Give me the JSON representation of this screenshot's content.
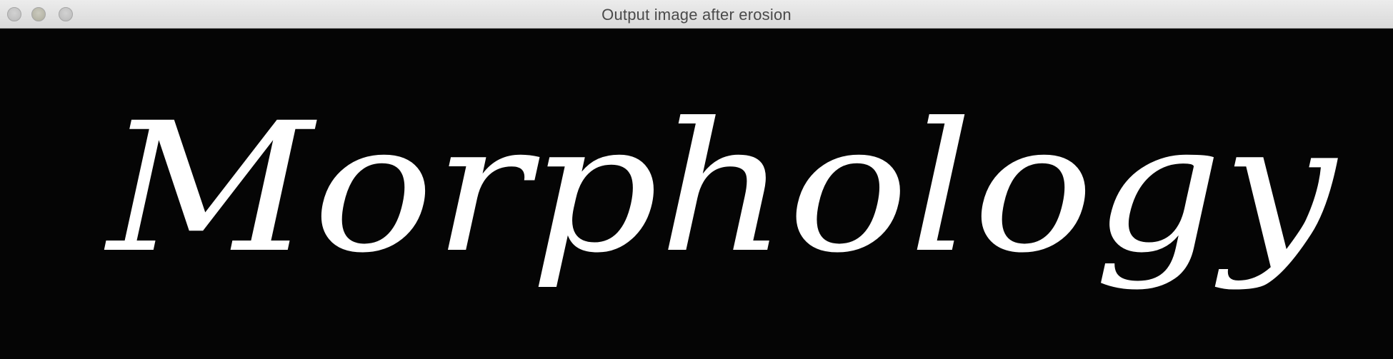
{
  "window": {
    "title": "Output image after erosion"
  },
  "image": {
    "text": "Morphology",
    "text_color": "#ffffff",
    "background_color": "#050505"
  },
  "colors": {
    "titlebar": "#e4e4e4",
    "title_text": "#4a4a4a"
  }
}
